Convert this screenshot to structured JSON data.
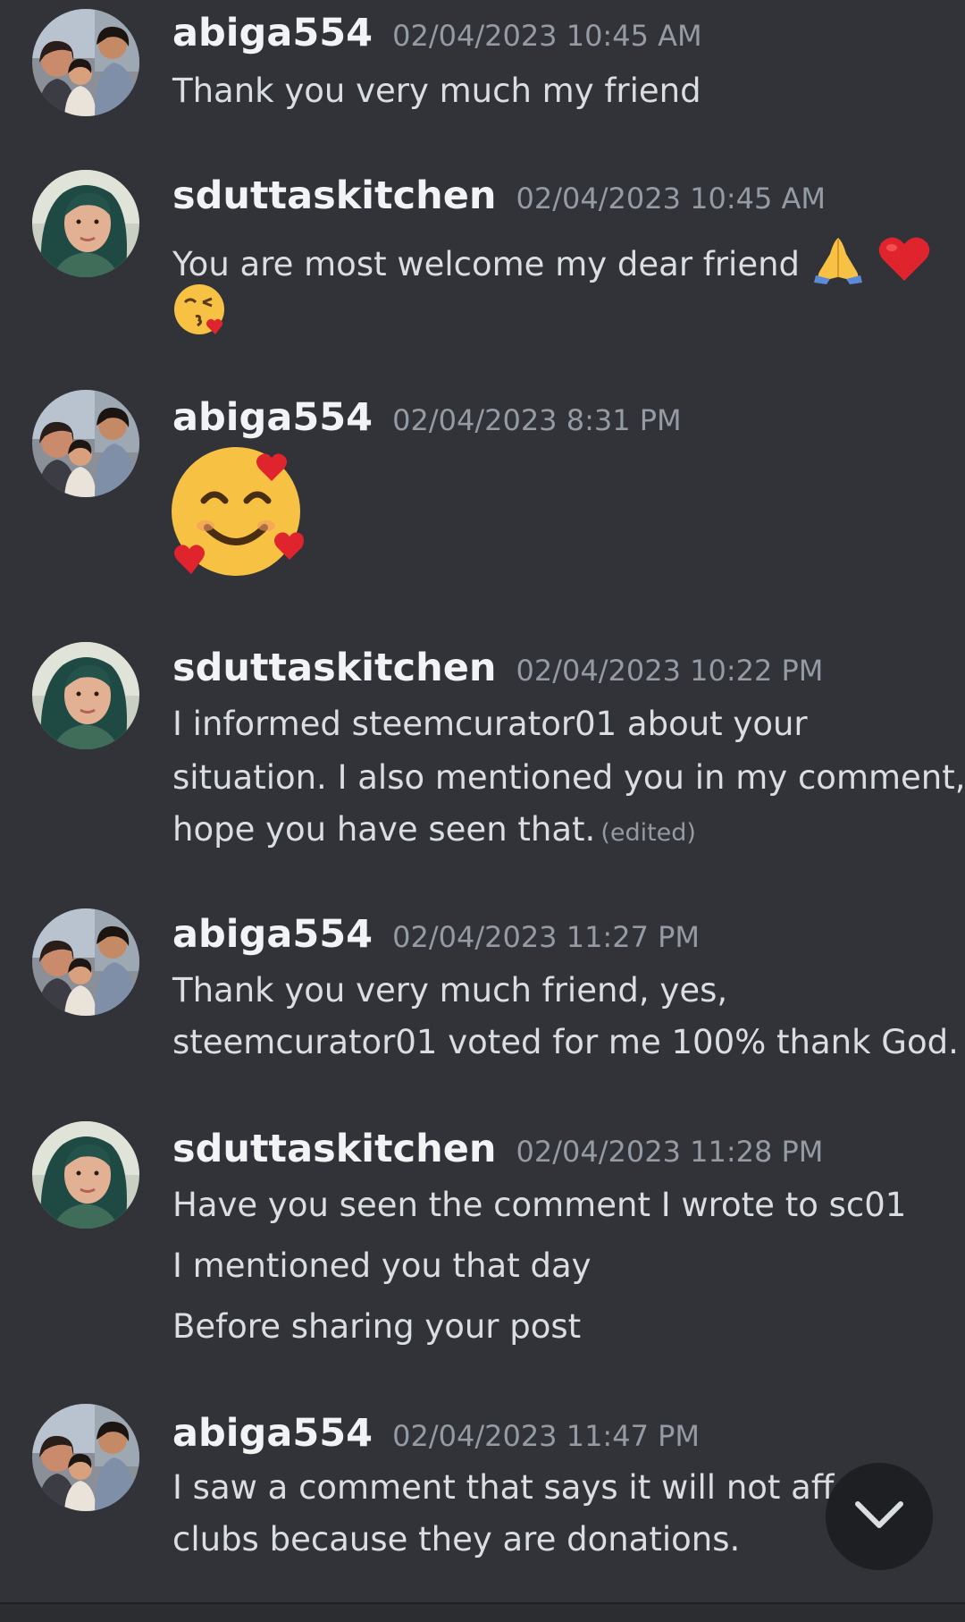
{
  "messages": [
    {
      "username": "abiga554",
      "timestamp": "02/04/2023 10:45 AM",
      "lines": [
        "Thank you very much my friend"
      ]
    },
    {
      "username": "sduttaskitchen",
      "timestamp": "02/04/2023 10:45 AM",
      "lines": [
        "You are most welcome my dear friend"
      ],
      "emojis": [
        "folded-hands",
        "red-heart",
        "face-blowing-kiss"
      ]
    },
    {
      "username": "abiga554",
      "timestamp": "02/04/2023 8:31 PM",
      "emojis": [
        "smiling-face-with-hearts"
      ]
    },
    {
      "username": "sduttaskitchen",
      "timestamp": "02/04/2023 10:22 PM",
      "lines": [
        "I informed steemcurator01 about your",
        "situation. I also mentioned you in my comment,",
        "hope you have seen that."
      ],
      "edited_label": "(edited)"
    },
    {
      "username": "abiga554",
      "timestamp": "02/04/2023 11:27 PM",
      "lines": [
        "Thank you very much friend, yes,",
        "steemcurator01 voted for me 100% thank God."
      ]
    },
    {
      "username": "sduttaskitchen",
      "timestamp": "02/04/2023 11:28 PM",
      "lines": [
        "Have you seen the comment I wrote to sc01",
        "I mentioned you that day",
        "Before sharing your post"
      ]
    },
    {
      "username": "abiga554",
      "timestamp": "02/04/2023 11:47 PM",
      "lines": [
        "I saw a comment that says it will not affec",
        "clubs because they are donations."
      ]
    }
  ],
  "scroll_button": {
    "icon": "chevron-down-icon"
  },
  "colors": {
    "background": "#313338",
    "username": "#f2f3f5",
    "timestamp": "#949ba4",
    "message_text": "#dbdee1",
    "scroll_button": "#1e1f22"
  }
}
